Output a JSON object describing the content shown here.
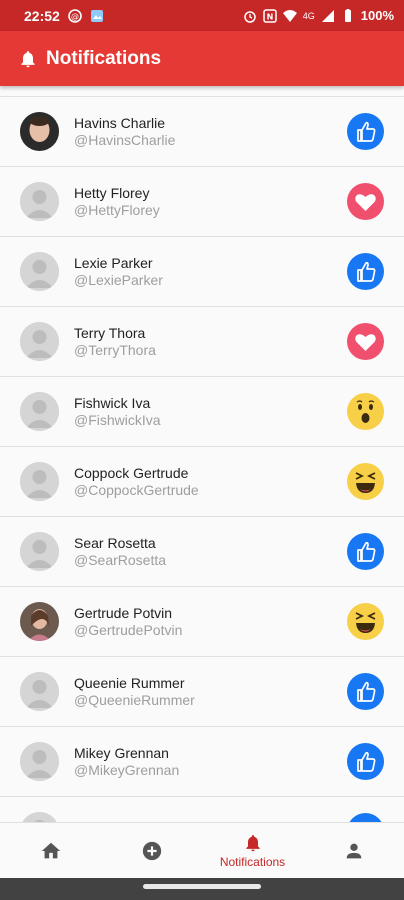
{
  "status": {
    "time": "22:52",
    "signal": "4G",
    "battery": "100%"
  },
  "appbar": {
    "title": "Notifications",
    "icon": "bell-icon"
  },
  "notifications": [
    {
      "name": "Havins Charlie",
      "handle": "@HavinsCharlie",
      "reaction": "like",
      "avatar": "photo"
    },
    {
      "name": "Hetty Florey",
      "handle": "@HettyFlorey",
      "reaction": "love",
      "avatar": "placeholder"
    },
    {
      "name": "Lexie Parker",
      "handle": "@LexieParker",
      "reaction": "like",
      "avatar": "placeholder"
    },
    {
      "name": "Terry Thora",
      "handle": "@TerryThora",
      "reaction": "love",
      "avatar": "placeholder"
    },
    {
      "name": "Fishwick Iva",
      "handle": "@FishwickIva",
      "reaction": "wow",
      "avatar": "placeholder"
    },
    {
      "name": "Coppock Gertrude",
      "handle": "@CoppockGertrude",
      "reaction": "haha",
      "avatar": "placeholder"
    },
    {
      "name": "Sear Rosetta",
      "handle": "@SearRosetta",
      "reaction": "like",
      "avatar": "placeholder"
    },
    {
      "name": "Gertrude Potvin",
      "handle": "@GertrudePotvin",
      "reaction": "haha",
      "avatar": "photo"
    },
    {
      "name": "Queenie Rummer",
      "handle": "@QueenieRummer",
      "reaction": "like",
      "avatar": "placeholder"
    },
    {
      "name": "Mikey Grennan",
      "handle": "@MikeyGrennan",
      "reaction": "like",
      "avatar": "placeholder"
    },
    {
      "name": "",
      "handle": "",
      "reaction": "like",
      "avatar": "placeholder"
    }
  ],
  "bottom_nav": {
    "items": [
      {
        "icon": "home-icon",
        "label": ""
      },
      {
        "icon": "add-circle-icon",
        "label": ""
      },
      {
        "icon": "bell-icon",
        "label": "Notifications",
        "active": true
      },
      {
        "icon": "person-icon",
        "label": ""
      }
    ]
  },
  "colors": {
    "status_bar": "#c62828",
    "app_bar": "#e53935",
    "like": "#1877f2",
    "love": "#f0506e",
    "emoji": "#f7d047",
    "active_nav": "#c62828"
  }
}
